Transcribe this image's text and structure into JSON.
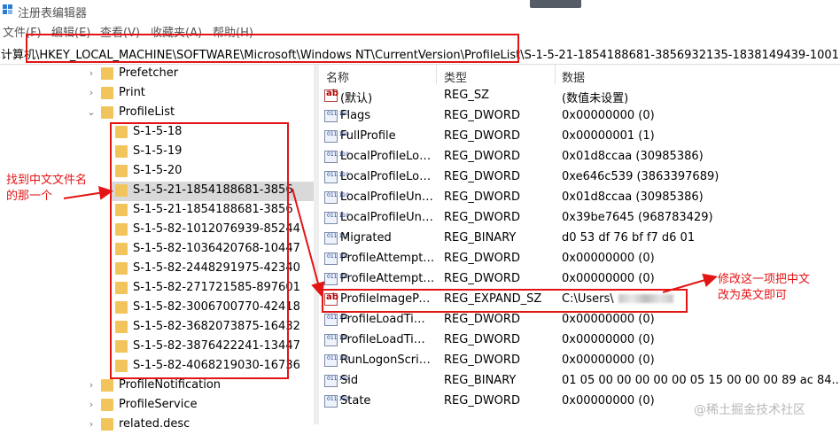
{
  "window": {
    "title": "注册表编辑器"
  },
  "menu": [
    "文件(F)",
    "编辑(E)",
    "查看(V)",
    "收藏夹(A)",
    "帮助(H)"
  ],
  "address": "计算机\\HKEY_LOCAL_MACHINE\\SOFTWARE\\Microsoft\\Windows NT\\CurrentVersion\\ProfileList\\S-1-5-21-1854188681-3856932135-1838149439-1001",
  "tree": [
    {
      "label": "Prefetcher",
      "twisty": "›"
    },
    {
      "label": "Print",
      "twisty": "›"
    },
    {
      "label": "ProfileList",
      "twisty": "⌄"
    },
    {
      "label": "S-1-5-18",
      "twisty": ""
    },
    {
      "label": "S-1-5-19",
      "twisty": ""
    },
    {
      "label": "S-1-5-20",
      "twisty": ""
    },
    {
      "label": "S-1-5-21-1854188681-3856",
      "twisty": ""
    },
    {
      "label": "S-1-5-21-1854188681-3856",
      "twisty": ""
    },
    {
      "label": "S-1-5-82-1012076939-85244",
      "twisty": ""
    },
    {
      "label": "S-1-5-82-1036420768-10447",
      "twisty": ""
    },
    {
      "label": "S-1-5-82-2448291975-42340",
      "twisty": ""
    },
    {
      "label": "S-1-5-82-271721585-897601",
      "twisty": ""
    },
    {
      "label": "S-1-5-82-3006700770-42418",
      "twisty": ""
    },
    {
      "label": "S-1-5-82-3682073875-16432",
      "twisty": ""
    },
    {
      "label": "S-1-5-82-3876422241-13447",
      "twisty": ""
    },
    {
      "label": "S-1-5-82-4068219030-16736",
      "twisty": ""
    },
    {
      "label": "ProfileNotification",
      "twisty": "›"
    },
    {
      "label": "ProfileService",
      "twisty": "›"
    },
    {
      "label": "related.desc",
      "twisty": "›"
    }
  ],
  "columns": {
    "name": "名称",
    "type": "类型",
    "data": "数据"
  },
  "values": [
    {
      "icon": "string-value-icon",
      "name": "(默认)",
      "type": "REG_SZ",
      "data": "(数值未设置)"
    },
    {
      "icon": "binary-value-icon",
      "name": "Flags",
      "type": "REG_DWORD",
      "data": "0x00000000 (0)"
    },
    {
      "icon": "binary-value-icon",
      "name": "FullProfile",
      "type": "REG_DWORD",
      "data": "0x00000001 (1)"
    },
    {
      "icon": "binary-value-icon",
      "name": "LocalProfileLoa...",
      "type": "REG_DWORD",
      "data": "0x01d8ccaa (30985386)"
    },
    {
      "icon": "binary-value-icon",
      "name": "LocalProfileLoa...",
      "type": "REG_DWORD",
      "data": "0xe646c539 (3863397689)"
    },
    {
      "icon": "binary-value-icon",
      "name": "LocalProfileUnlo...",
      "type": "REG_DWORD",
      "data": "0x01d8ccaa (30985386)"
    },
    {
      "icon": "binary-value-icon",
      "name": "LocalProfileUnlo...",
      "type": "REG_DWORD",
      "data": "0x39be7645 (968783429)"
    },
    {
      "icon": "binary-value-icon",
      "name": "Migrated",
      "type": "REG_BINARY",
      "data": "d0 53 df 76 bf f7 d6 01"
    },
    {
      "icon": "binary-value-icon",
      "name": "ProfileAttempte...",
      "type": "REG_DWORD",
      "data": "0x00000000 (0)"
    },
    {
      "icon": "binary-value-icon",
      "name": "ProfileAttempte...",
      "type": "REG_DWORD",
      "data": "0x00000000 (0)"
    },
    {
      "icon": "string-value-icon",
      "name": "ProfileImagePath",
      "type": "REG_EXPAND_SZ",
      "data": "C:\\Users\\"
    },
    {
      "icon": "binary-value-icon",
      "name": "ProfileLoadTime...",
      "type": "REG_DWORD",
      "data": "0x00000000 (0)"
    },
    {
      "icon": "binary-value-icon",
      "name": "ProfileLoadTime...",
      "type": "REG_DWORD",
      "data": "0x00000000 (0)"
    },
    {
      "icon": "binary-value-icon",
      "name": "RunLogonScript...",
      "type": "REG_DWORD",
      "data": "0x00000000 (0)"
    },
    {
      "icon": "binary-value-icon",
      "name": "Sid",
      "type": "REG_BINARY",
      "data": "01 05 00 00 00 00 00 05 15 00 00 00 89 ac 84..."
    },
    {
      "icon": "binary-value-icon",
      "name": "State",
      "type": "REG_DWORD",
      "data": "0x00000000 (0)"
    }
  ],
  "annotations": {
    "find_chinese_folder": [
      "找到中文文件名",
      "的那一个"
    ],
    "modify_entry": [
      "修改这一项把中文",
      "改为英文即可"
    ]
  },
  "watermark": "@稀土掘金技术社区",
  "colors": {
    "annotation_red": "#e31414",
    "folder_yellow": "#f2c55c",
    "selection_gray": "#d9d9d9"
  }
}
